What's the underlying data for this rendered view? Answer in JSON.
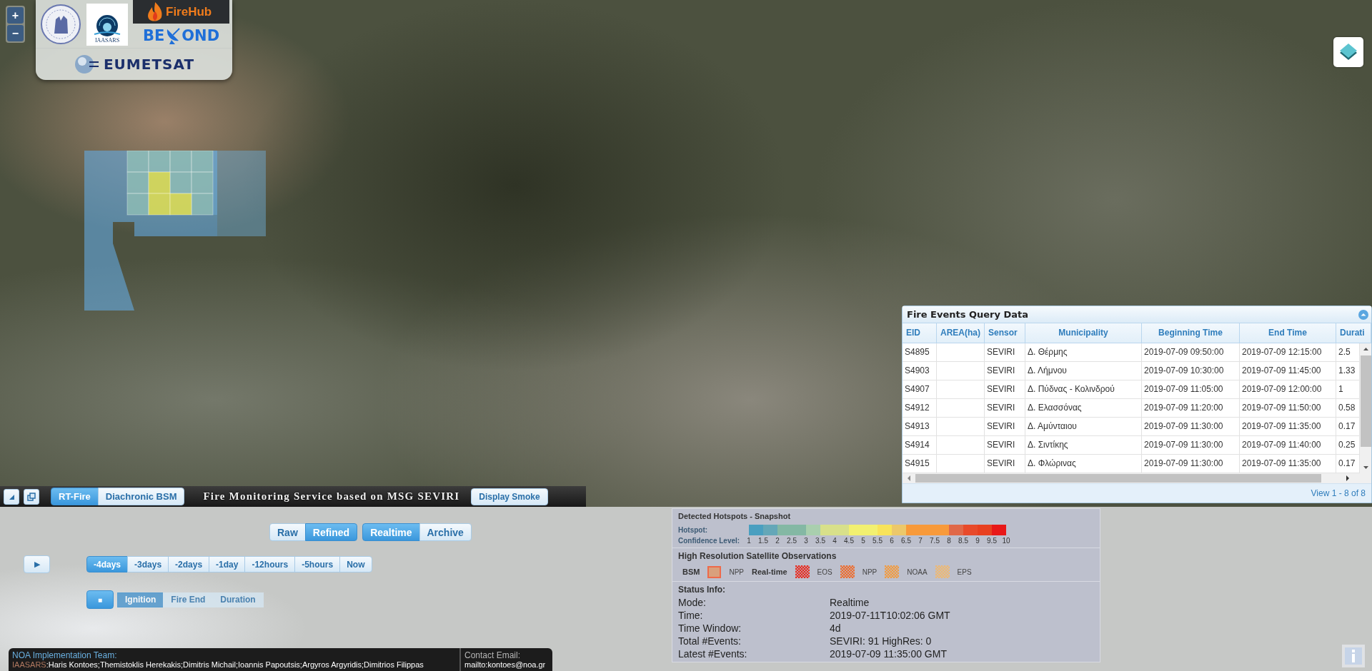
{
  "map_controls": {
    "zoom_in": "+",
    "zoom_out": "−"
  },
  "logos": {
    "institute": "IAASARS",
    "firehub": "FireHub",
    "beyond": [
      "BE",
      "OND"
    ],
    "eumetsat": "EUMETSAT"
  },
  "toolbar": {
    "mode_tabs": [
      {
        "label": "RT-Fire",
        "selected": true
      },
      {
        "label": "Diachronic BSM",
        "selected": false
      }
    ],
    "title": "Fire Monitoring Service based on MSG SEVIRI",
    "smoke_button": "Display Smoke"
  },
  "query_panel": {
    "title": "Fire Events Query Data",
    "columns": [
      "EID",
      "AREA(ha)",
      "Sensor",
      "Municipality",
      "Beginning Time",
      "End Time",
      "Durati"
    ],
    "rows": [
      {
        "eid": "S4895",
        "sensor": "SEVIRI",
        "municipality": "Δ. Θέρμης",
        "beginning_time": "2019-07-09 09:50:00",
        "end_time": "2019-07-09 12:15:00",
        "duration": "2.5"
      },
      {
        "eid": "S4903",
        "sensor": "SEVIRI",
        "municipality": "Δ. Λήμνου",
        "beginning_time": "2019-07-09 10:30:00",
        "end_time": "2019-07-09 11:45:00",
        "duration": "1.33"
      },
      {
        "eid": "S4907",
        "sensor": "SEVIRI",
        "municipality": "Δ. Πύδνας - Κολινδρού",
        "beginning_time": "2019-07-09 11:05:00",
        "end_time": "2019-07-09 12:00:00",
        "duration": "1"
      },
      {
        "eid": "S4912",
        "sensor": "SEVIRI",
        "municipality": "Δ. Ελασσόνας",
        "beginning_time": "2019-07-09 11:20:00",
        "end_time": "2019-07-09 11:50:00",
        "duration": "0.58"
      },
      {
        "eid": "S4913",
        "sensor": "SEVIRI",
        "municipality": "Δ. Αμύνταιου",
        "beginning_time": "2019-07-09 11:30:00",
        "end_time": "2019-07-09 11:35:00",
        "duration": "0.17"
      },
      {
        "eid": "S4914",
        "sensor": "SEVIRI",
        "municipality": "Δ. Σιντίκης",
        "beginning_time": "2019-07-09 11:30:00",
        "end_time": "2019-07-09 11:40:00",
        "duration": "0.25"
      },
      {
        "eid": "S4915",
        "sensor": "SEVIRI",
        "municipality": "Δ. Φλώρινας",
        "beginning_time": "2019-07-09 11:30:00",
        "end_time": "2019-07-09 11:35:00",
        "duration": "0.17"
      }
    ],
    "pager": "View 1 - 8 of 8"
  },
  "controls": {
    "product_toggle": [
      {
        "label": "Raw",
        "selected": false
      },
      {
        "label": "Refined",
        "selected": true
      }
    ],
    "mode_toggle": [
      {
        "label": "Realtime",
        "selected": true
      },
      {
        "label": "Archive",
        "selected": false
      }
    ],
    "play_button": "▶",
    "time_ranges": [
      {
        "label": "-4days",
        "selected": true
      },
      {
        "label": "-3days",
        "selected": false
      },
      {
        "label": "-2days",
        "selected": false
      },
      {
        "label": "-1day",
        "selected": false
      },
      {
        "label": "-12hours",
        "selected": false
      },
      {
        "label": "-5hours",
        "selected": false
      },
      {
        "label": "Now",
        "selected": false
      }
    ],
    "stop_button": "■",
    "timeline_fields": {
      "disabled": true,
      "options": [
        {
          "label": "Ignition",
          "selected": true
        },
        {
          "label": "Fire End",
          "selected": false
        },
        {
          "label": "Duration",
          "selected": false
        }
      ]
    }
  },
  "footer": {
    "team_heading": "NOA Implementation Team:",
    "team_org": "IAASARS",
    "team_members": ":Haris Kontoes;Themistoklis Herekakis;Dimitris Michail;Ioannis Papoutsis;Argyros Argyridis;Dimitrios Filippas",
    "contact_heading": "Contact Email:",
    "contact": "mailto:kontoes@noa.gr"
  },
  "legend": {
    "hotspots": {
      "title": "Detected Hotspots - Snapshot",
      "hotspot_label": "Hotspot:",
      "confidence_label": "Confidence Level:",
      "colors": [
        {
          "color": "#4a9fc0"
        },
        {
          "color": "#64a7b8"
        },
        {
          "color": "#84b8a4"
        },
        {
          "color": "#84b8a4"
        },
        {
          "color": "#a9cfae"
        },
        {
          "color": "#d8e08a"
        },
        {
          "color": "#d8e08a"
        },
        {
          "color": "#f2f070"
        },
        {
          "color": "#f2f070"
        },
        {
          "color": "#f8e35a"
        },
        {
          "color": "#ecc86a"
        },
        {
          "color": "#f89a3a"
        },
        {
          "color": "#f89a3a"
        },
        {
          "color": "#f89a3a"
        },
        {
          "color": "#e06848"
        },
        {
          "color": "#e84a2a"
        },
        {
          "color": "#e84020"
        },
        {
          "color": "#e81818"
        }
      ],
      "ticks": [
        "1",
        "1.5",
        "2",
        "2.5",
        "3",
        "3.5",
        "4",
        "4.5",
        "5",
        "5.5",
        "6",
        "6.5",
        "7",
        "7.5",
        "8",
        "8.5",
        "9",
        "9.5",
        "10"
      ]
    },
    "observations": {
      "title": "High Resolution Satellite Observations",
      "items": [
        {
          "kind": "heading",
          "label": "BSM"
        },
        {
          "kind": "swatch",
          "color": "#d9a07c"
        },
        {
          "kind": "label",
          "label": "NPP"
        },
        {
          "kind": "heading",
          "label": "Real-time"
        },
        {
          "kind": "hatch",
          "color": "#e8281c"
        },
        {
          "kind": "label",
          "label": "EOS"
        },
        {
          "kind": "hatch",
          "color": "#ee6a2a"
        },
        {
          "kind": "label",
          "label": "NPP"
        },
        {
          "kind": "hatch",
          "color": "#f39a3c"
        },
        {
          "kind": "label",
          "label": "NOAA"
        },
        {
          "kind": "hatch",
          "color": "#f0b870"
        },
        {
          "kind": "label",
          "label": "EPS"
        }
      ]
    },
    "status": {
      "title": "Status Info:",
      "rows": [
        {
          "label": "Mode:",
          "value": "Realtime"
        },
        {
          "label": "Time:",
          "value": "2019-07-11T10:02:06 GMT"
        },
        {
          "label": "Time Window:",
          "value": "4d"
        },
        {
          "label": "Total #Events:",
          "value": "SEVIRI: 91  HighRes: 0"
        },
        {
          "label": "Latest #Events:",
          "value": "2019-07-09 11:35:00 GMT"
        }
      ]
    }
  }
}
